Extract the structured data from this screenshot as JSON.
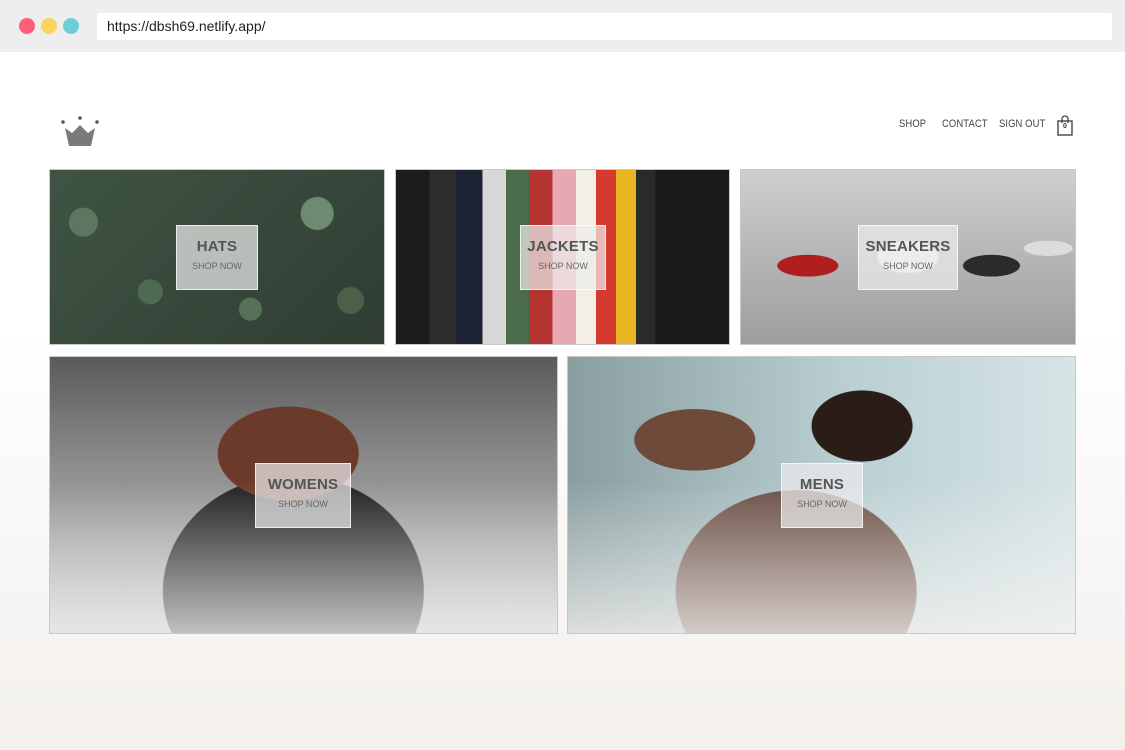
{
  "browser": {
    "url": "https://dbsh69.netlify.app/"
  },
  "header": {
    "logo_icon": "crown-icon",
    "nav": [
      {
        "label": "SHOP"
      },
      {
        "label": "CONTACT"
      },
      {
        "label": "SIGN OUT"
      }
    ],
    "cart": {
      "icon": "shopping-bag-icon",
      "count": "0"
    }
  },
  "directory": [
    {
      "title": "HATS",
      "subtitle": "SHOP NOW"
    },
    {
      "title": "JACKETS",
      "subtitle": "SHOP NOW"
    },
    {
      "title": "SNEAKERS",
      "subtitle": "SHOP NOW"
    },
    {
      "title": "WOMENS",
      "subtitle": "SHOP NOW"
    },
    {
      "title": "MENS",
      "subtitle": "SHOP NOW"
    }
  ],
  "colors": {
    "dot_red": "#fd5f79",
    "dot_yellow": "#fdd35b",
    "dot_teal": "#6ccfd6",
    "text": "#555555"
  }
}
